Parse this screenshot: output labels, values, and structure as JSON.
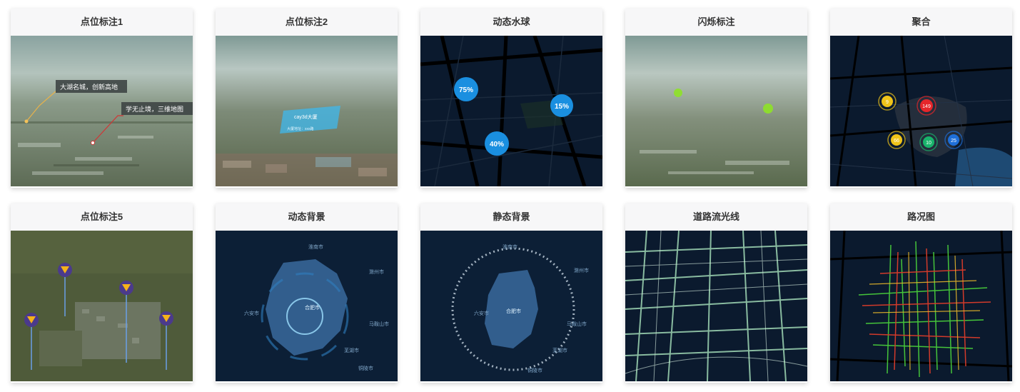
{
  "cards": [
    {
      "title": "点位标注1",
      "labels": [
        "大湖名城，创新高地",
        "学无止境，三维地图"
      ]
    },
    {
      "title": "点位标注2",
      "labels": [
        "cay3d大厦",
        "大厦地址：xxx路"
      ]
    },
    {
      "title": "动态水球",
      "balls": [
        {
          "label": "75%",
          "value": 0.75
        },
        {
          "label": "15%",
          "value": 0.15
        },
        {
          "label": "40%",
          "value": 0.4
        }
      ]
    },
    {
      "title": "闪烁标注"
    },
    {
      "title": "聚合",
      "clusters": [
        {
          "label": "9",
          "color": "#f0c419"
        },
        {
          "label": "149",
          "color": "#e5262a"
        },
        {
          "label": "66",
          "color": "#f0c419"
        },
        {
          "label": "10",
          "color": "#19b36b"
        },
        {
          "label": "25",
          "color": "#1e6fd9"
        }
      ]
    },
    {
      "title": "点位标注5"
    },
    {
      "title": "动态背景",
      "map_labels": [
        "淮南市",
        "滁州市",
        "合肥市",
        "六安市",
        "马鞍山市",
        "芜湖市",
        "铜陵市"
      ]
    },
    {
      "title": "静态背景",
      "map_labels": [
        "淮南市",
        "滁州市",
        "合肥市",
        "六安市",
        "马鞍山市",
        "芜湖市",
        "铜陵市"
      ]
    },
    {
      "title": "道路流光线"
    },
    {
      "title": "路况图"
    }
  ],
  "colors": {
    "dark_map": "#0b1a2e",
    "water_ball": "#1a8fe0",
    "road_glow": "#9fd8b4"
  }
}
